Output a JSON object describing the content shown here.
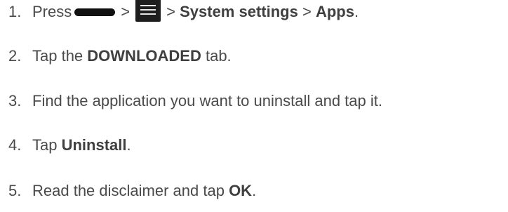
{
  "steps": [
    {
      "number": "1.",
      "press": "Press",
      "sep1": ">",
      "sep2": ">",
      "system_settings": "System settings",
      "sep3": ">",
      "apps": "Apps",
      "end": "."
    },
    {
      "number": "2.",
      "before": "Tap the",
      "bold": "DOWNLOADED",
      "after": "tab."
    },
    {
      "number": "3.",
      "text": "Find the application you want to uninstall and tap it."
    },
    {
      "number": "4.",
      "before": "Tap",
      "bold": "Uninstall",
      "after": "."
    },
    {
      "number": "5.",
      "before": "Read the disclaimer and tap",
      "bold": "OK",
      "after": "."
    }
  ],
  "icons": {
    "home_key": "home-key-icon",
    "menu_key": "menu-key-icon"
  }
}
